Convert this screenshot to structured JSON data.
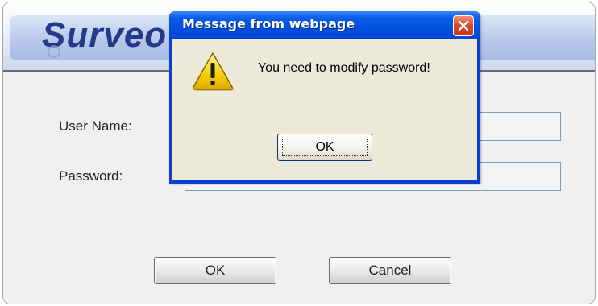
{
  "login": {
    "logo_text": "Surveo",
    "username_label": "User Name:",
    "password_label": "Password:",
    "username_value": "",
    "password_value": "",
    "ok_label": "OK",
    "cancel_label": "Cancel"
  },
  "dialog": {
    "title": "Message from webpage",
    "message": "You need to modify password!",
    "ok_label": "OK",
    "icon": "warning-icon",
    "close_icon": "close-icon"
  },
  "colors": {
    "titlebar": "#0050e0",
    "dialog_body": "#ece9d8",
    "logo": "#233a8b",
    "close_button": "#d9462a"
  }
}
